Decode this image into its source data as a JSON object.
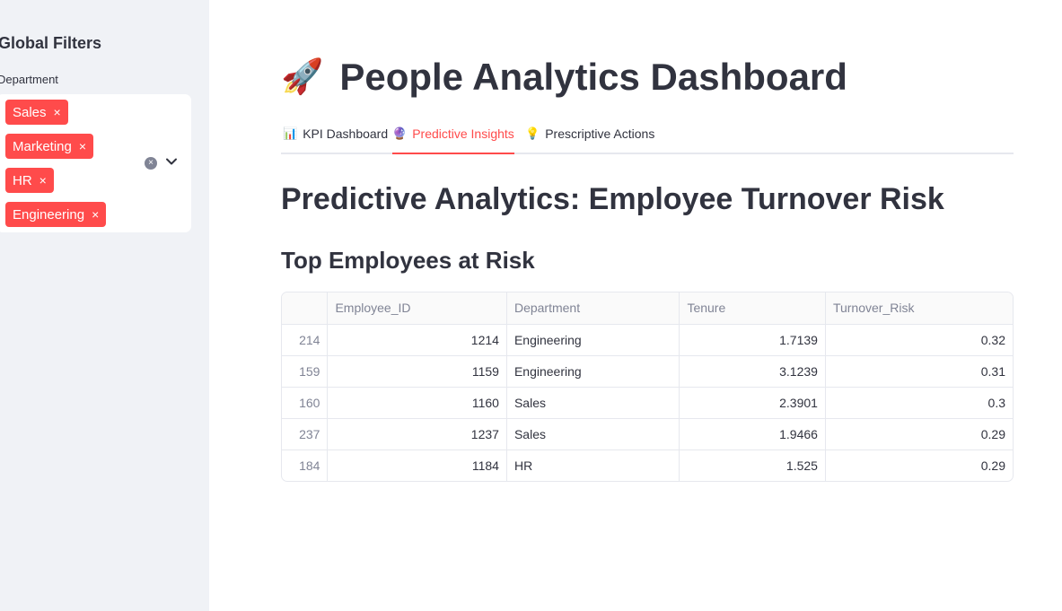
{
  "sidebar": {
    "title": "Global Filters",
    "department_label": "Department",
    "selected": [
      "Sales",
      "Marketing",
      "HR",
      "Engineering"
    ],
    "chip_remove_glyph": "×",
    "clear_glyph": "×"
  },
  "header": {
    "rocket": "🚀",
    "title": "People Analytics Dashboard"
  },
  "tabs": [
    {
      "icon": "📊",
      "label": "KPI Dashboard"
    },
    {
      "icon": "🔮",
      "label": "Predictive Insights"
    },
    {
      "icon": "💡",
      "label": "Prescriptive Actions"
    }
  ],
  "content": {
    "heading": "Predictive Analytics: Employee Turnover Risk",
    "subheading": "Top Employees at Risk"
  },
  "table": {
    "columns": [
      "",
      "Employee_ID",
      "Department",
      "Tenure",
      "Turnover_Risk"
    ],
    "rows": [
      [
        "214",
        "1214",
        "Engineering",
        "1.7139",
        "0.32"
      ],
      [
        "159",
        "1159",
        "Engineering",
        "3.1239",
        "0.31"
      ],
      [
        "160",
        "1160",
        "Sales",
        "2.3901",
        "0.3"
      ],
      [
        "237",
        "1237",
        "Sales",
        "1.9466",
        "0.29"
      ],
      [
        "184",
        "1184",
        "HR",
        "1.525",
        "0.29"
      ]
    ]
  },
  "colors": {
    "accent": "#ff4b4b",
    "sidebar_bg": "#f0f2f6",
    "text": "#31333f",
    "muted": "#808495"
  }
}
